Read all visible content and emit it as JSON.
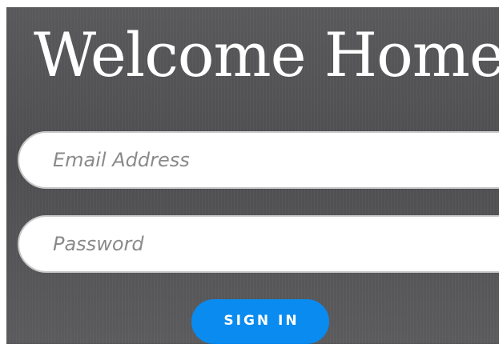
{
  "login": {
    "title": "Welcome Home",
    "email_placeholder": "Email Address",
    "email_value": "",
    "password_placeholder": "Password",
    "password_value": "",
    "submit_label": "SIGN IN"
  },
  "colors": {
    "background": "#545456",
    "title_text": "#ffffff",
    "field_background": "#ffffff",
    "placeholder_text": "#8a8a8a",
    "button_background": "#0a8bf0",
    "button_text": "#ffffff"
  }
}
